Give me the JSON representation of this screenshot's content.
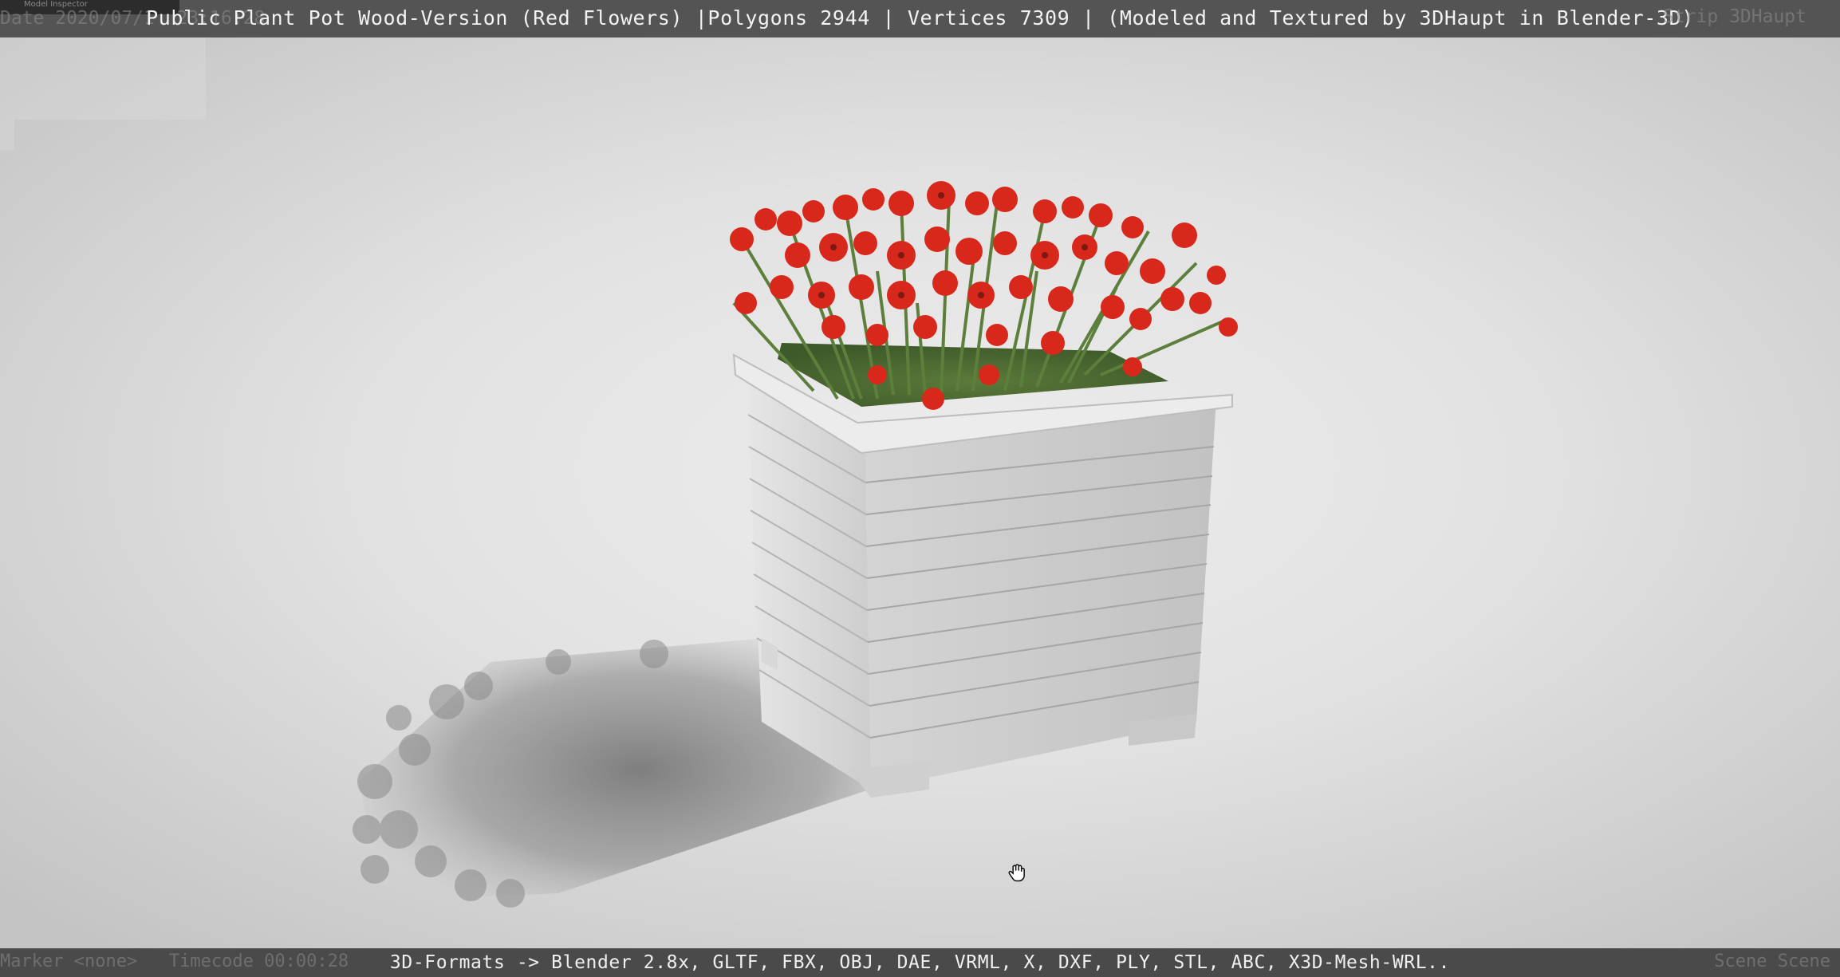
{
  "header": {
    "title": "Public Plant Pot Wood-Version (Red Flowers) |Polygons 2944 | Vertices 7309 | (Modeled and Textured by 3DHaupt in Blender-3D)",
    "inspector_label": "Model Inspector",
    "ghost_date": "Date 2020/07/1  23:16:28",
    "ghost_strip": "Strip 3DHaupt"
  },
  "viewport": {
    "subject": "wooden plant pot with red flowers",
    "cursor_icon": "hand-grab-icon"
  },
  "footer": {
    "formats": "3D-Formats -> Blender 2.8x, GLTF, FBX, OBJ, DAE, VRML, X, DXF, PLY, STL, ABC, X3D-Mesh-WRL..",
    "ghost_marker": "Marker <none>   Timecode 00:00:28",
    "ghost_scene": "Scene Scene"
  },
  "colors": {
    "topbar": "#545454",
    "bottombar": "#4a4a4a",
    "flower_red": "#d8281c",
    "wood": "#d9d9d9"
  }
}
